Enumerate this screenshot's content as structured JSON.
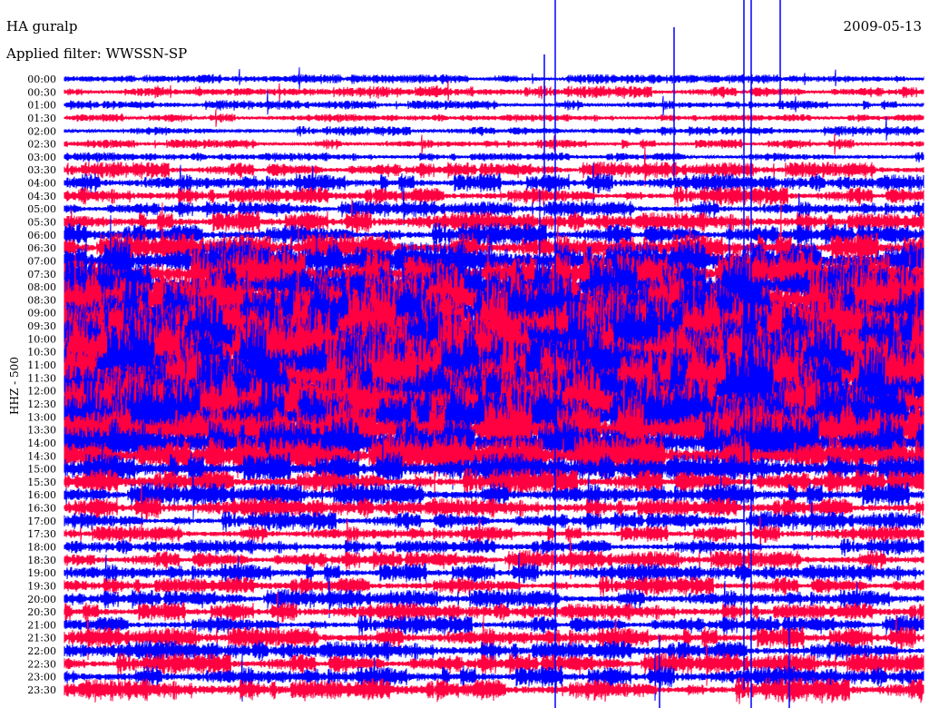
{
  "header": {
    "station": "HA guralp",
    "filter": "Applied filter: WWSSN-SP",
    "date": "2009-05-13"
  },
  "chart_data": {
    "type": "line",
    "title": "HA guralp",
    "subtitle": "Applied filter: WWSSN-SP",
    "date": "2009-05-13",
    "ylabel": "HHZ - 500",
    "xlabel": "",
    "row_labels": [
      "00:00",
      "00:30",
      "01:00",
      "01:30",
      "02:00",
      "02:30",
      "03:00",
      "03:30",
      "04:00",
      "04:30",
      "05:00",
      "05:30",
      "06:00",
      "06:30",
      "07:00",
      "07:30",
      "08:00",
      "08:30",
      "09:00",
      "09:30",
      "10:00",
      "10:30",
      "11:00",
      "11:30",
      "12:00",
      "12:30",
      "13:00",
      "13:30",
      "14:00",
      "14:30",
      "15:00",
      "15:30",
      "16:00",
      "16:30",
      "17:00",
      "17:30",
      "18:00",
      "18:30",
      "19:00",
      "19:30",
      "20:00",
      "20:30",
      "21:00",
      "21:30",
      "22:00",
      "22:30",
      "23:00",
      "23:30"
    ],
    "series_colors": [
      "#0000ff",
      "#ff0040"
    ],
    "relative_amplitude": [
      0.35,
      0.45,
      0.35,
      0.3,
      0.35,
      0.35,
      0.35,
      0.6,
      0.7,
      0.7,
      0.6,
      0.8,
      0.9,
      1.1,
      1.6,
      1.8,
      2.2,
      2.6,
      3.0,
      3.2,
      3.3,
      3.3,
      3.3,
      3.2,
      3.2,
      3.0,
      2.8,
      2.4,
      2.0,
      1.6,
      1.2,
      1.0,
      0.9,
      0.8,
      0.7,
      0.6,
      0.6,
      0.7,
      0.7,
      0.7,
      0.7,
      0.7,
      0.7,
      0.8,
      0.8,
      0.8,
      0.8,
      0.9
    ],
    "grid": false
  }
}
